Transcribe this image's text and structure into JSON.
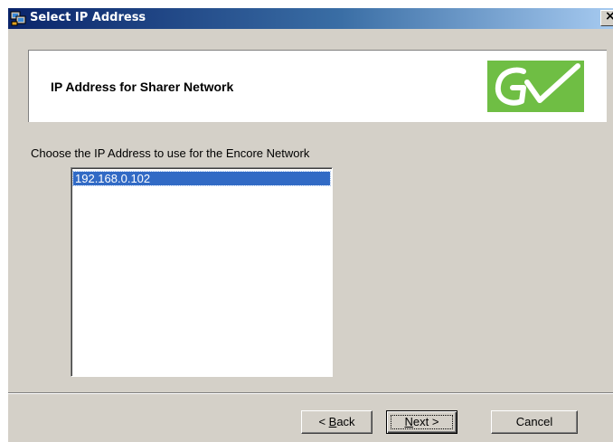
{
  "window": {
    "title": "Select IP Address",
    "close_glyph": "×"
  },
  "header": {
    "title": "IP Address for Sharer Network",
    "logo": "GV"
  },
  "prompt": "Choose the IP Address to use for the Encore Network",
  "ip_list": {
    "items": [
      "192.168.0.102"
    ],
    "selected_index": 0
  },
  "buttons": {
    "back": {
      "prefix": "< ",
      "accel": "B",
      "rest": "ack"
    },
    "next": {
      "accel": "N",
      "rest": "ext >"
    },
    "cancel": "Cancel"
  },
  "colors": {
    "title_bar_start": "#0a246a",
    "title_bar_end": "#a6caf0",
    "selection": "#316ac5",
    "logo_green": "#6fbe44"
  },
  "icons": [
    "network-computer-icon",
    "close-icon",
    "gv-logo"
  ]
}
